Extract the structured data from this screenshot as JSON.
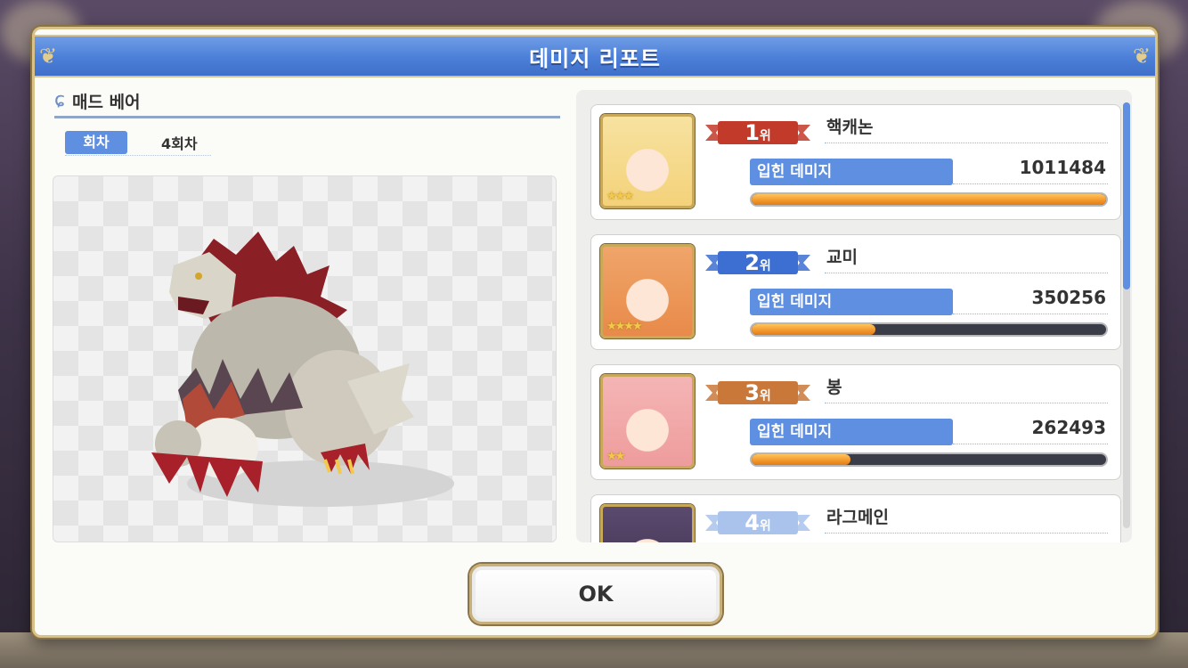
{
  "dialog": {
    "title": "데미지 리포트"
  },
  "boss": {
    "name": "매드 베어",
    "round_label": "회차",
    "round_value": "4회차"
  },
  "ranking": [
    {
      "rank": "1",
      "suffix": "위",
      "name": "핵캐논",
      "damage_label": "입힌 데미지",
      "damage": "1011484",
      "fill_fraction": 1.0,
      "stars": "★★★",
      "ribbon_color": "#c23a2a"
    },
    {
      "rank": "2",
      "suffix": "위",
      "name": "교미",
      "damage_label": "입힌 데미지",
      "damage": "350256",
      "fill_fraction": 0.35,
      "stars": "★★★★",
      "ribbon_color": "#3c6fd1"
    },
    {
      "rank": "3",
      "suffix": "위",
      "name": "봉",
      "damage_label": "입힌 데미지",
      "damage": "262493",
      "fill_fraction": 0.28,
      "stars": "★★",
      "ribbon_color": "#c9783a"
    },
    {
      "rank": "4",
      "suffix": "위",
      "name": "라그메인",
      "damage_label": "",
      "damage": "",
      "fill_fraction": 0,
      "stars": "",
      "ribbon_color": "#a9c3ec"
    }
  ],
  "buttons": {
    "ok": "OK"
  }
}
